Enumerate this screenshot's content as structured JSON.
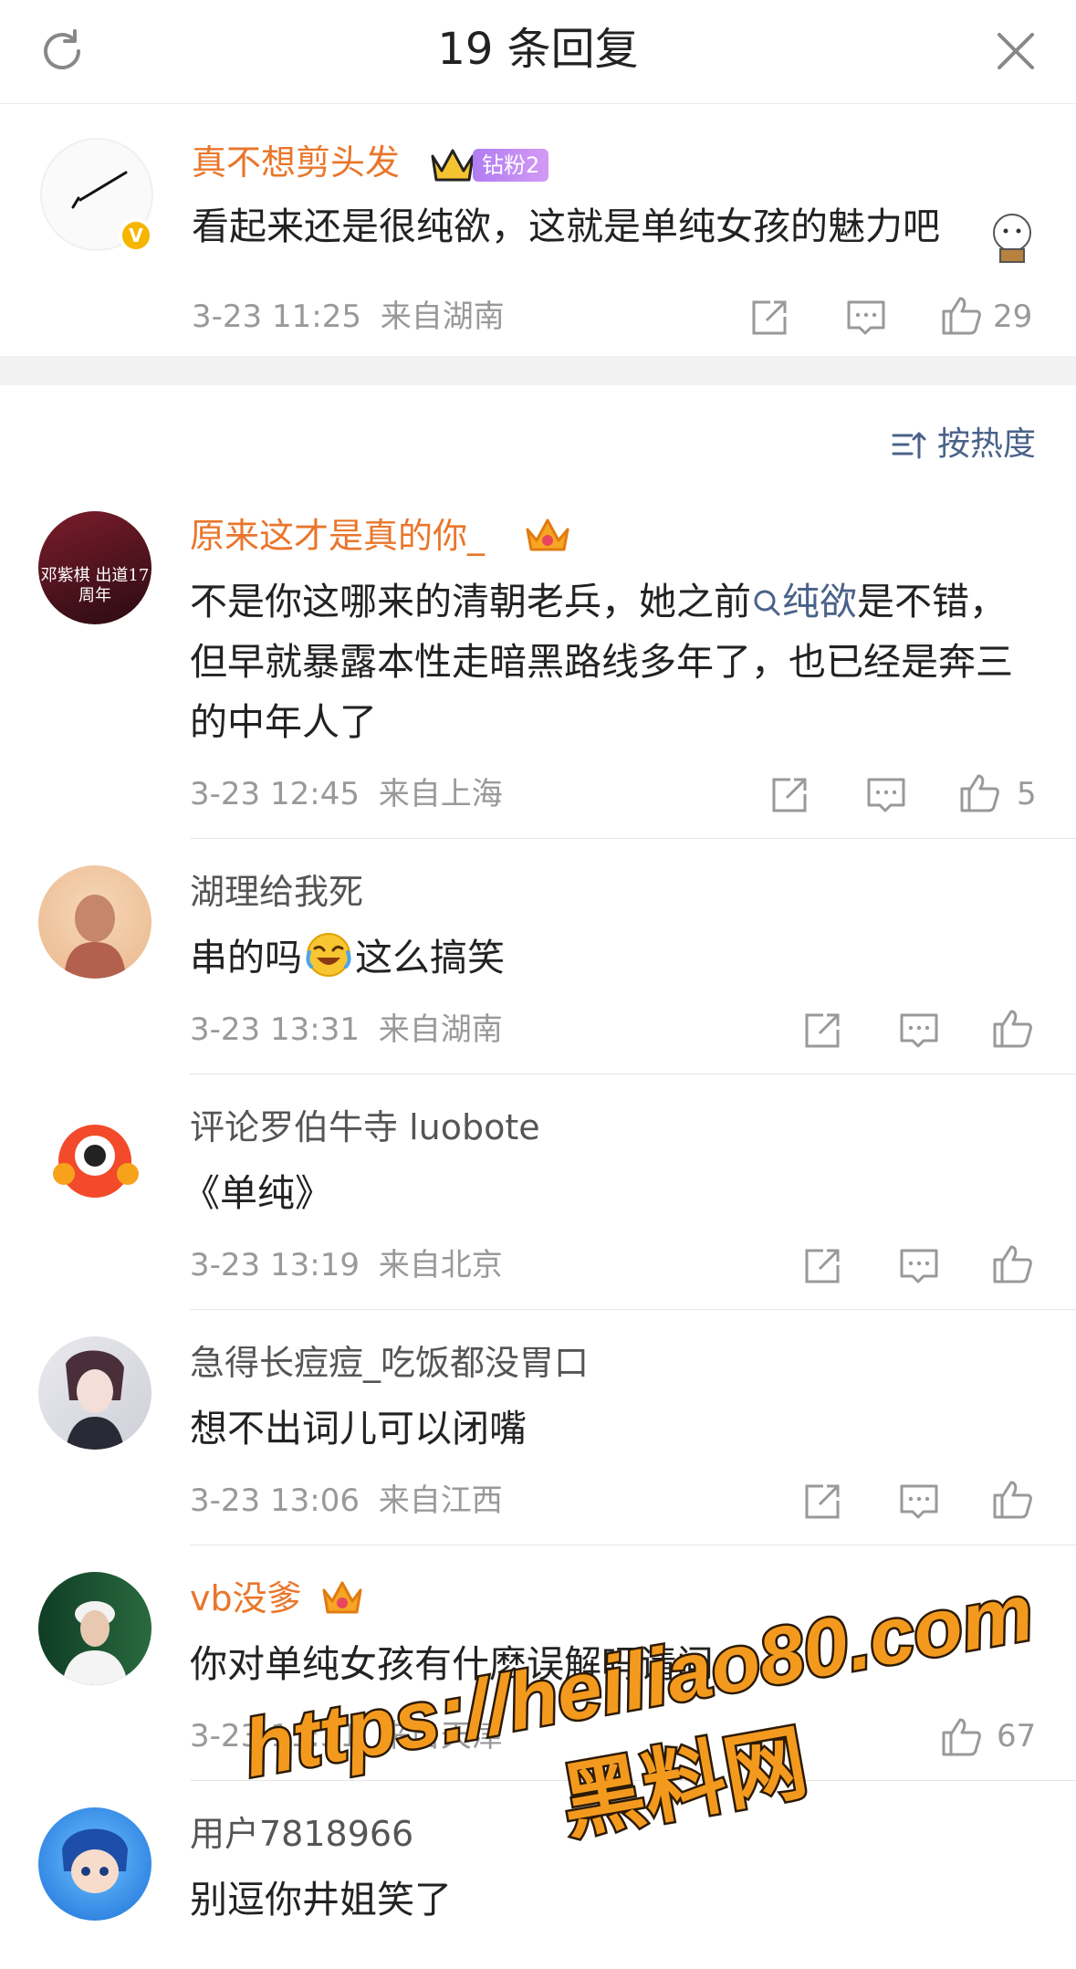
{
  "header": {
    "title": "19 条回复"
  },
  "root_comment": {
    "username": "真不想剪头发",
    "badge": "钻粉2",
    "text": "看起来还是很纯欲，这就是单纯女孩的魅力吧",
    "time": "3-23 11:25",
    "location": "来自湖南",
    "likes": "29"
  },
  "sort": {
    "label": "按热度"
  },
  "replies": [
    {
      "username": "原来这才是真的你_",
      "avatar_text": "邓紫棋 出道17周年",
      "text_a": "不是你这哪来的清朝老兵，她之前",
      "topic": "纯欲",
      "text_b": "是不错，但早就暴露本性走暗黑路线多年了，也已经是奔三的中年人了",
      "time": "3-23 12:45",
      "location": "来自上海",
      "likes": "5"
    },
    {
      "username": "湖理给我死",
      "text_a": "串的吗",
      "text_b": "这么搞笑",
      "time": "3-23 13:31",
      "location": "来自湖南",
      "likes": ""
    },
    {
      "username": "评论罗伯牛寺 luobote",
      "text": "《单纯》",
      "time": "3-23 13:19",
      "location": "来自北京",
      "likes": ""
    },
    {
      "username": "急得长痘痘_吃饭都没胃口",
      "text": "想不出词儿可以闭嘴",
      "time": "3-23 13:06",
      "location": "来自江西",
      "likes": ""
    },
    {
      "username": "vb没爹",
      "text": "你对单纯女孩有什麽误解吗请问",
      "time": "3-23 11:31",
      "location": "来自天津",
      "likes": "67"
    },
    {
      "username": "用户7818966",
      "text": "别逗你井姐笑了"
    }
  ],
  "watermark": {
    "line1": "https://heiliao80.com",
    "line2": "黑料网"
  },
  "colors": {
    "accent_name": "#e9762b",
    "link": "#4a6289",
    "meta": "#999999"
  }
}
